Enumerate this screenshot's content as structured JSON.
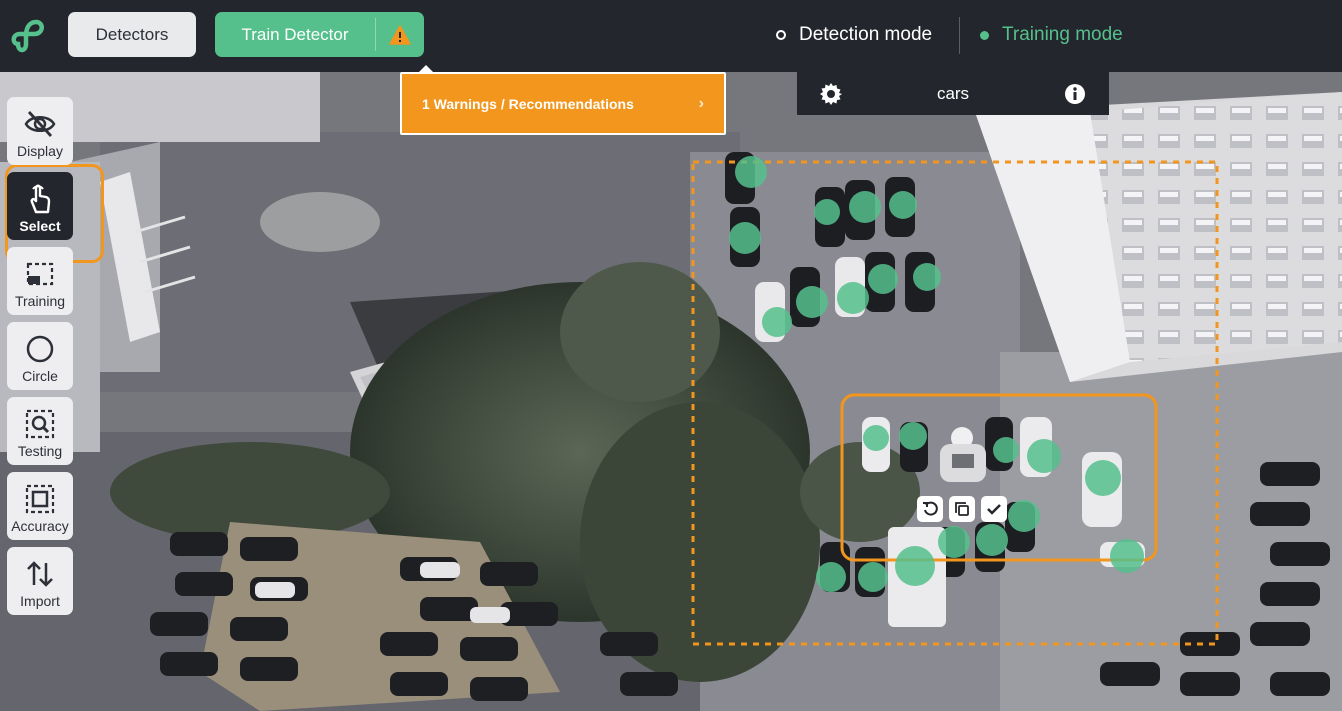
{
  "topbar": {
    "logo_icon": "logo-icon",
    "detectors_label": "Detectors",
    "train_label": "Train Detector",
    "warning_icon": "warning-triangle-icon",
    "detection_mode_label": "Detection mode",
    "training_mode_label": "Training mode",
    "active_mode": "Training mode"
  },
  "warnings": {
    "label": "1 Warnings / Recommendations",
    "chevron": "›"
  },
  "class_bar": {
    "name": "cars",
    "gear_icon": "gear-icon",
    "info_icon": "info-icon"
  },
  "tools": [
    {
      "label": "Display",
      "icon": "eye-slash-icon"
    },
    {
      "label": "Select",
      "icon": "pointer-hand-icon",
      "active": true
    },
    {
      "label": "Training",
      "icon": "training-region-icon"
    },
    {
      "label": "Circle",
      "icon": "circle-icon"
    },
    {
      "label": "Testing",
      "icon": "testing-region-icon"
    },
    {
      "label": "Accuracy",
      "icon": "accuracy-region-icon"
    },
    {
      "label": "Import",
      "icon": "import-arrows-icon"
    }
  ],
  "region_tools": [
    "undo-icon",
    "copy-icon",
    "check-icon"
  ],
  "colors": {
    "accent_green": "#55c08c",
    "warning_orange": "#f2961d",
    "topbar_bg": "#24262d"
  }
}
